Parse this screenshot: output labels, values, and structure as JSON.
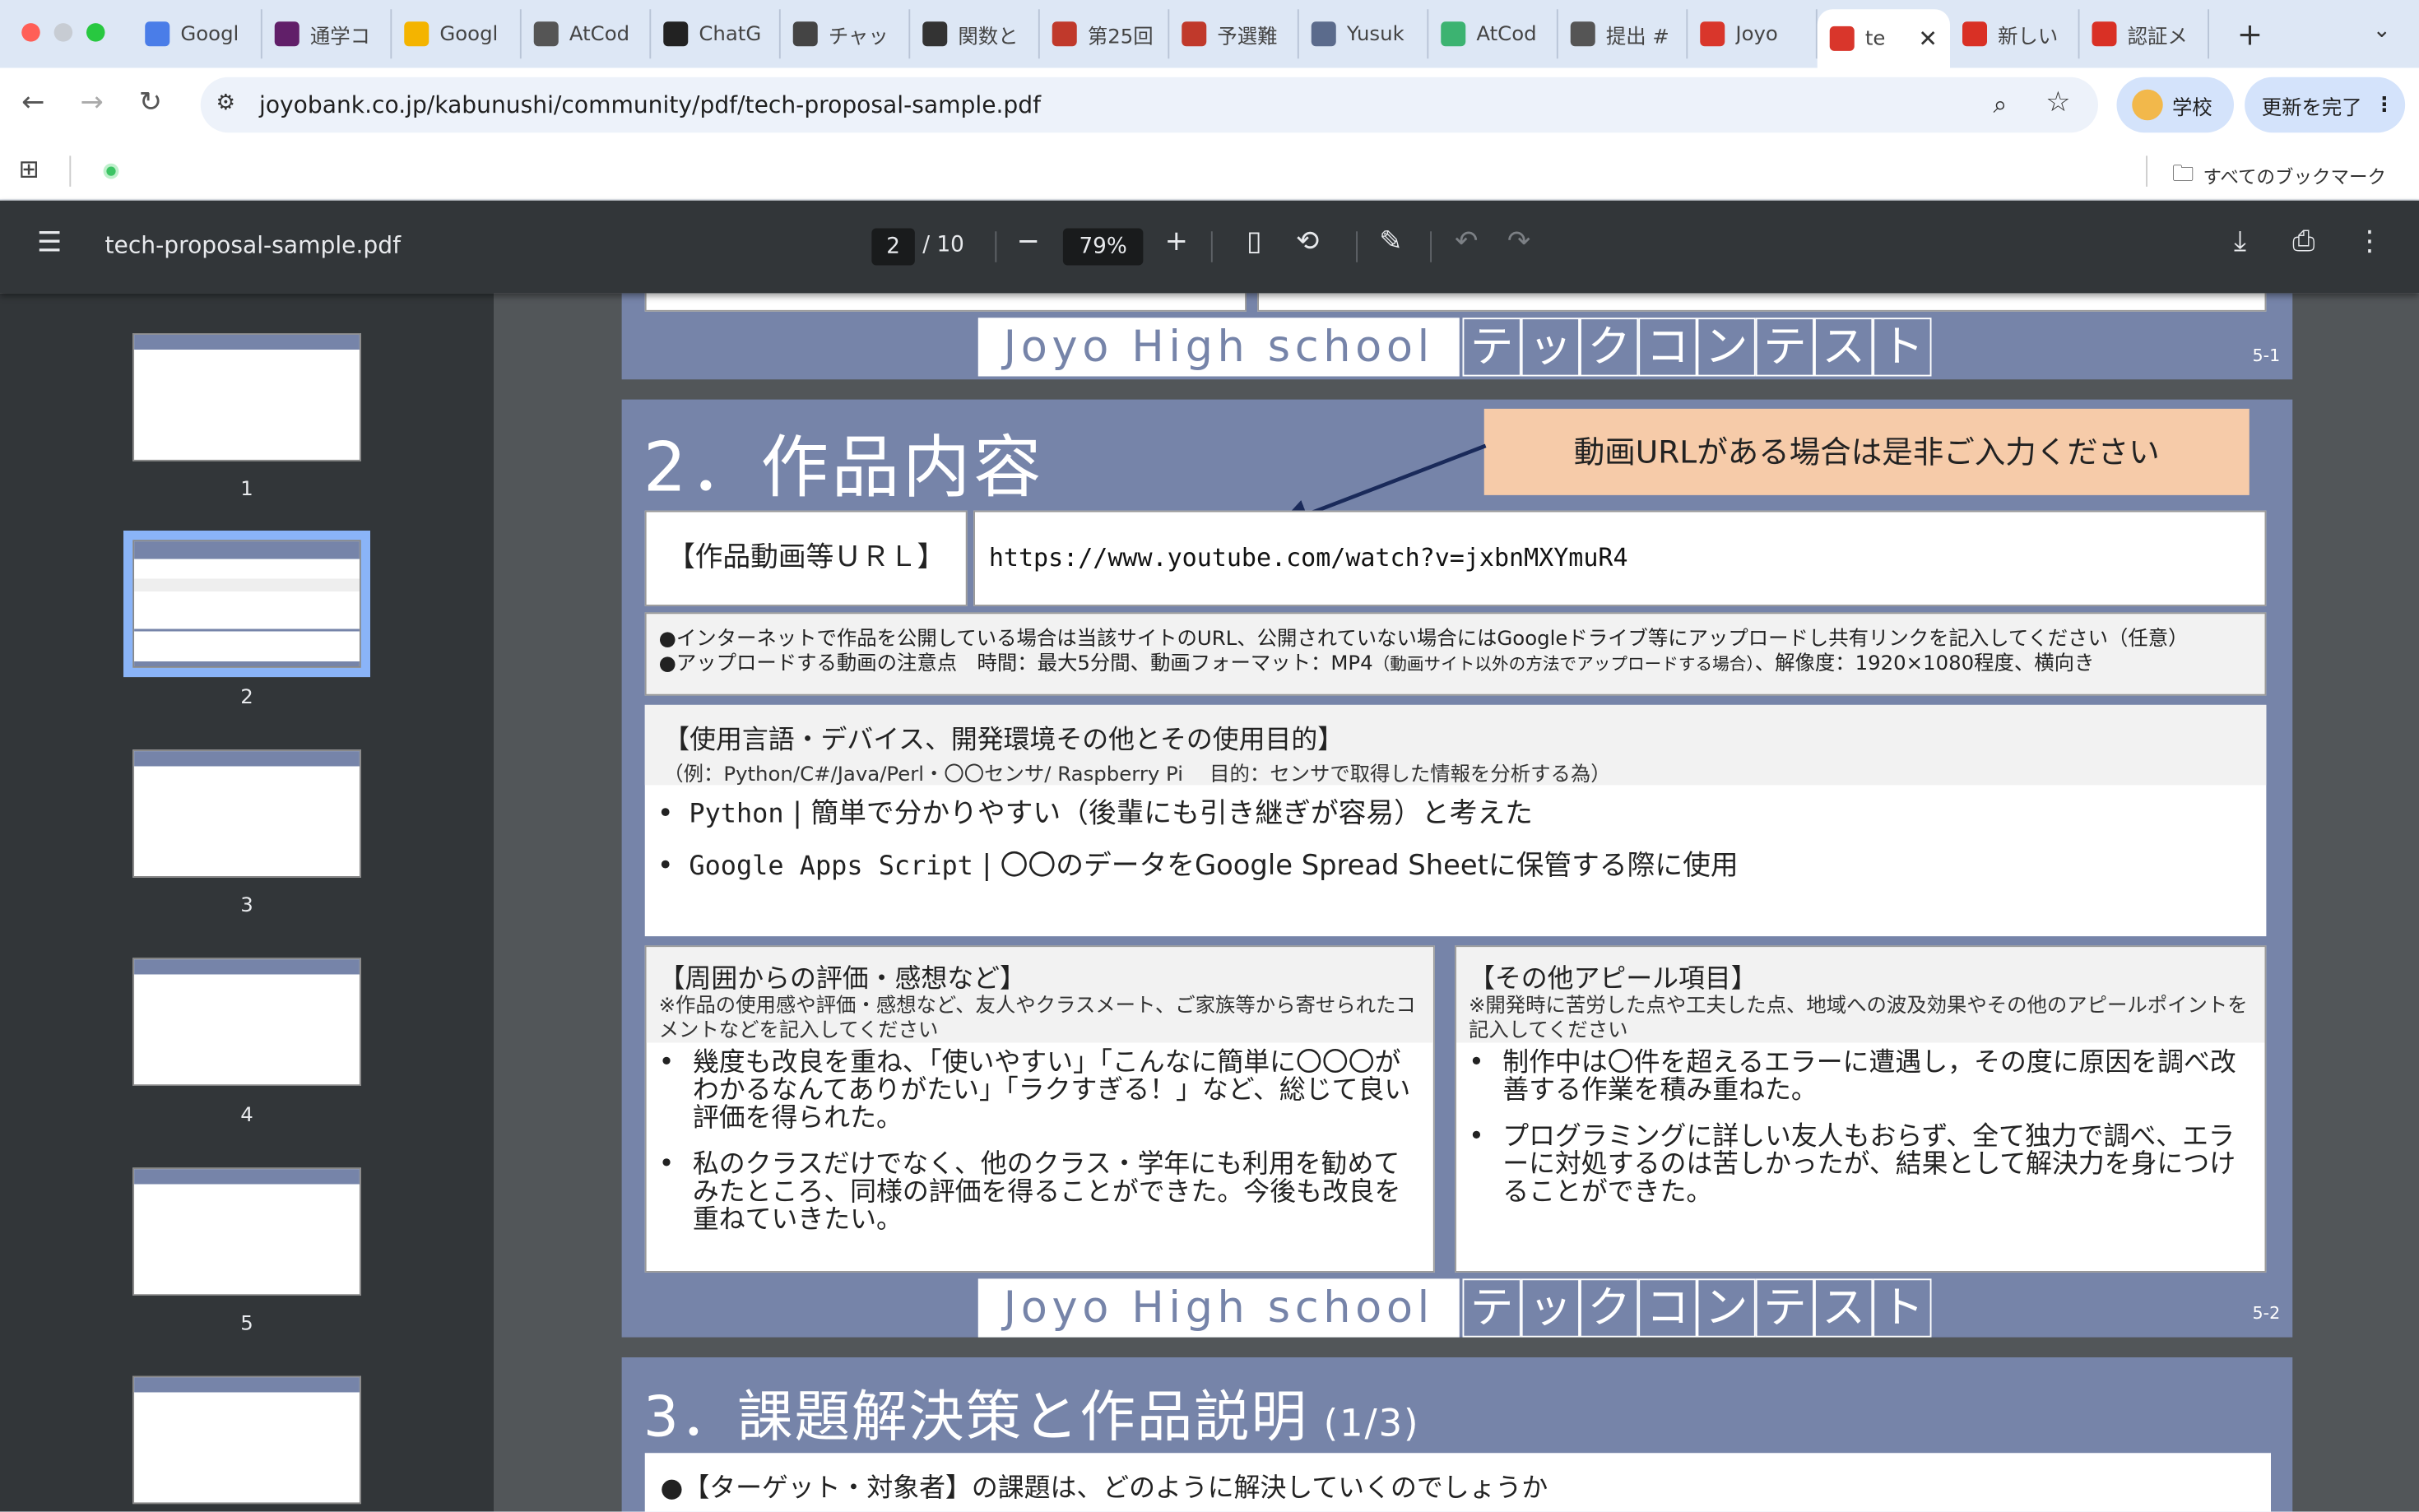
{
  "browser": {
    "tabs": [
      {
        "title": "Googl",
        "icon": "gemini-icon",
        "color": "#4a7de8"
      },
      {
        "title": "通学コ",
        "icon": "slack-icon",
        "color": "#611f69"
      },
      {
        "title": "Googl",
        "icon": "keep-icon",
        "color": "#f4b400"
      },
      {
        "title": "AtCod",
        "icon": "atcoder-icon",
        "color": "#555555"
      },
      {
        "title": "ChatG",
        "icon": "github-icon",
        "color": "#222222"
      },
      {
        "title": "チャッ",
        "icon": "globe-icon",
        "color": "#444444"
      },
      {
        "title": "関数と",
        "icon": "openai-icon",
        "color": "#333333"
      },
      {
        "title": "第25回",
        "icon": "contest-icon",
        "color": "#c0392b"
      },
      {
        "title": "予選難",
        "icon": "contest-icon",
        "color": "#c0392b"
      },
      {
        "title": "Yusuk",
        "icon": "yusuke-icon",
        "color": "#5b6b8c"
      },
      {
        "title": "AtCod",
        "icon": "atcoder-green-icon",
        "color": "#3cb371"
      },
      {
        "title": "提出 #",
        "icon": "atcoder-icon",
        "color": "#555555"
      },
      {
        "title": "Joyo",
        "icon": "joyo-icon",
        "color": "#d9362b"
      },
      {
        "title": "te",
        "icon": "joyo-icon",
        "color": "#d9362b",
        "active": true
      },
      {
        "title": "新しい",
        "icon": "gmail-icon",
        "color": "#d93025"
      },
      {
        "title": "認証メ",
        "icon": "gmail-icon",
        "color": "#d93025"
      }
    ],
    "new_tab": "+",
    "tab_menu": "⌄",
    "url": "joyobank.co.jp/kabunushi/community/pdf/tech-proposal-sample.pdf",
    "profile_label": "学校",
    "update_label": "更新を完了",
    "all_bookmarks": "すべてのブックマーク"
  },
  "pdf": {
    "filename": "tech-proposal-sample.pdf",
    "page": "2",
    "total": "/ 10",
    "zoom": "79%",
    "thumbnails": [
      "1",
      "2",
      "3",
      "4",
      "5"
    ]
  },
  "slide1": {
    "banner_en": "Joyo High school",
    "banner_kana": [
      "テ",
      "ッ",
      "ク",
      "コ",
      "ン",
      "テ",
      "ス",
      "ト"
    ],
    "number": "5-1"
  },
  "slide2": {
    "title": "2．作品内容",
    "callout": "動画URLがある場合は是非ご入力ください",
    "url_label": "【作品動画等ＵＲＬ】",
    "url_value": "https://www.youtube.com/watch?v=jxbnMXYmuR4",
    "note1": "●インターネットで作品を公開している場合は当該サイトのURL、公開されていない場合にはGoogleドライブ等にアップロードし共有リンクを記入してください（任意）",
    "note2a": "●アップロードする動画の注意点　時間：最大5分間、動画フォーマット：MP4",
    "note2b": "（動画サイト以外の方法でアップロードする場合）",
    "note2c": "、解像度：1920×1080程度、横向き",
    "tools_heading": "【使用言語・デバイス、開発環境その他とその使用目的】",
    "tools_example": "（例：Python/C#/Java/Perl・〇〇センサ/ Raspberry Pi　 目的：センサで取得した情報を分析する為）",
    "tools": [
      {
        "name": "Python",
        "desc": "簡単で分かりやすい（後輩にも引き継ぎが容易）と考えた"
      },
      {
        "name": "Google Apps Script",
        "desc": "〇〇のデータをGoogle Spread Sheetに保管する際に使用"
      }
    ],
    "eval_heading": "【周囲からの評価・感想など】",
    "eval_note": "※作品の使用感や評価・感想など、友人やクラスメート、ご家族等から寄せられたコメントなどを記入してください",
    "eval_items": [
      "幾度も改良を重ね、「使いやすい」「こんなに簡単に〇〇〇がわかるなんてありがたい」「ラクすぎる！」など、総じて良い評価を得られた。",
      "私のクラスだけでなく、他のクラス・学年にも利用を勧めてみたところ、同様の評価を得ることができた。今後も改良を重ねていきたい。"
    ],
    "appeal_heading": "【その他アピール項目】",
    "appeal_note": "※開発時に苦労した点や工夫した点、地域への波及効果やその他のアピールポイントを記入してください",
    "appeal_items": [
      "制作中は〇件を超えるエラーに遭遇し，その度に原因を調べ改善する作業を積み重ねた。",
      "プログラミングに詳しい友人もおらず、全て独力で調べ、エラーに対処するのは苦しかったが、結果として解決力を身につけることができた。"
    ],
    "banner_en": "Joyo High school",
    "number": "5-2"
  },
  "slide3": {
    "title": "3．課題解決策と作品説明",
    "subtitle": "(1/3)",
    "question": "●【ターゲット・対象者】の課題は、どのように解決していくのでしょうか"
  }
}
